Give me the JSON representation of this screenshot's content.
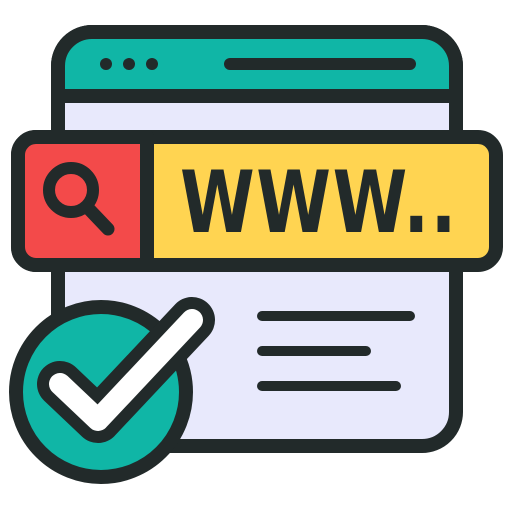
{
  "icon": {
    "name": "website-search-verified-icon",
    "url_text": "WWW..",
    "colors": {
      "outline": "#222a2a",
      "header": "#10b6a6",
      "page": "#e8e9fc",
      "search_bar": "#ffd451",
      "search_button": "#f34a4a",
      "check_badge": "#10b6a6",
      "check_mark": "#ffffff"
    }
  }
}
